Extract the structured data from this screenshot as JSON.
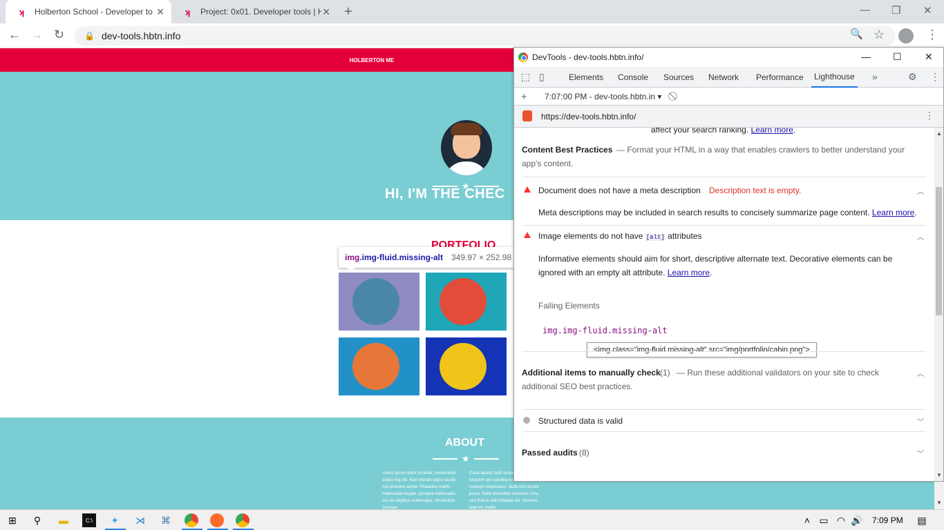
{
  "browser": {
    "tabs": [
      {
        "title": "Holberton School - Developer to",
        "active": true
      },
      {
        "title": "Project: 0x01. Developer tools | H",
        "active": false
      }
    ],
    "url": "dev-tools.hbtn.info"
  },
  "page": {
    "nav_text": "HOLBERTON ME",
    "hero_title": "HI, I'M THE CHEC",
    "portfolio_title": "PORTFOLIO",
    "about_title": "ABOUT",
    "about_col1": "Lorem ipsum dolor sit amet, consectetur adipiscing elit. Nam blandit turpis iaculis nisl pharetra auctor. Phasellus mattis malesuada feugiat. Quisque malesuada orci eu dapibus scelerisque. Vestibulum Quisque",
    "about_col2": "Class aptent taciti sociosqu ad litora torquent per conubia nostra, per inceptos himenaeos. Nulla non ornare purus. Nulla bibendum maximus urna, sed finibus velit tristique vel. Vivamus ante mi, mollis",
    "inspect_tooltip": {
      "tag": "img",
      "classes": ".img-fluid.missing-alt",
      "size": "349.97 × 252.98"
    }
  },
  "devtools": {
    "window_title": "DevTools - dev-tools.hbtn.info/",
    "tabs": [
      "Elements",
      "Console",
      "Sources",
      "Network",
      "Performance",
      "Lighthouse"
    ],
    "active_tab": "Lighthouse",
    "report_selector": "7:07:00 PM - dev-tools.hbtn.in",
    "report_url": "https://dev-tools.hbtn.info/",
    "report": {
      "prev_tail": "affect your search ranking.",
      "learn_more": "Learn more",
      "section_title": "Content Best Practices",
      "section_desc_1": "— Format your HTML in a way that enables crawlers to better understand your",
      "section_desc_2": "app's content.",
      "audit1_title": "Document does not have a meta description",
      "audit1_error": "Description text is empty.",
      "audit1_desc": "Meta descriptions may be included in search results to concisely summarize page content.",
      "audit2_title_pre": "Image elements do not have",
      "audit2_code": "[alt]",
      "audit2_title_post": "attributes",
      "audit2_desc_1": "Informative elements should aim for short, descriptive alternate text. Decorative elements can be",
      "audit2_desc_2": "ignored with an empty alt attribute.",
      "failing_label": "Failing Elements",
      "failing_node_tag": "img",
      "failing_node_cls": ".img-fluid.missing-alt",
      "node_tooltip": "<img class=\"img-fluid missing-alt\" src=\"img/portfolio/cabin.png\">",
      "manual_title": "Additional items to manually check",
      "manual_count": "(1)",
      "manual_desc_1": "— Run these additional validators on your site to check",
      "manual_desc_2": "additional SEO best practices.",
      "structured": "Structured data is valid",
      "passed_title": "Passed audits",
      "passed_count": "(8)"
    }
  },
  "taskbar": {
    "time": "7:09 PM"
  },
  "colors": {
    "brand_red": "#e3003a",
    "hero_teal": "#7acdd3",
    "lighthouse_fail": "#ff3333",
    "link": "#1a0dab"
  }
}
